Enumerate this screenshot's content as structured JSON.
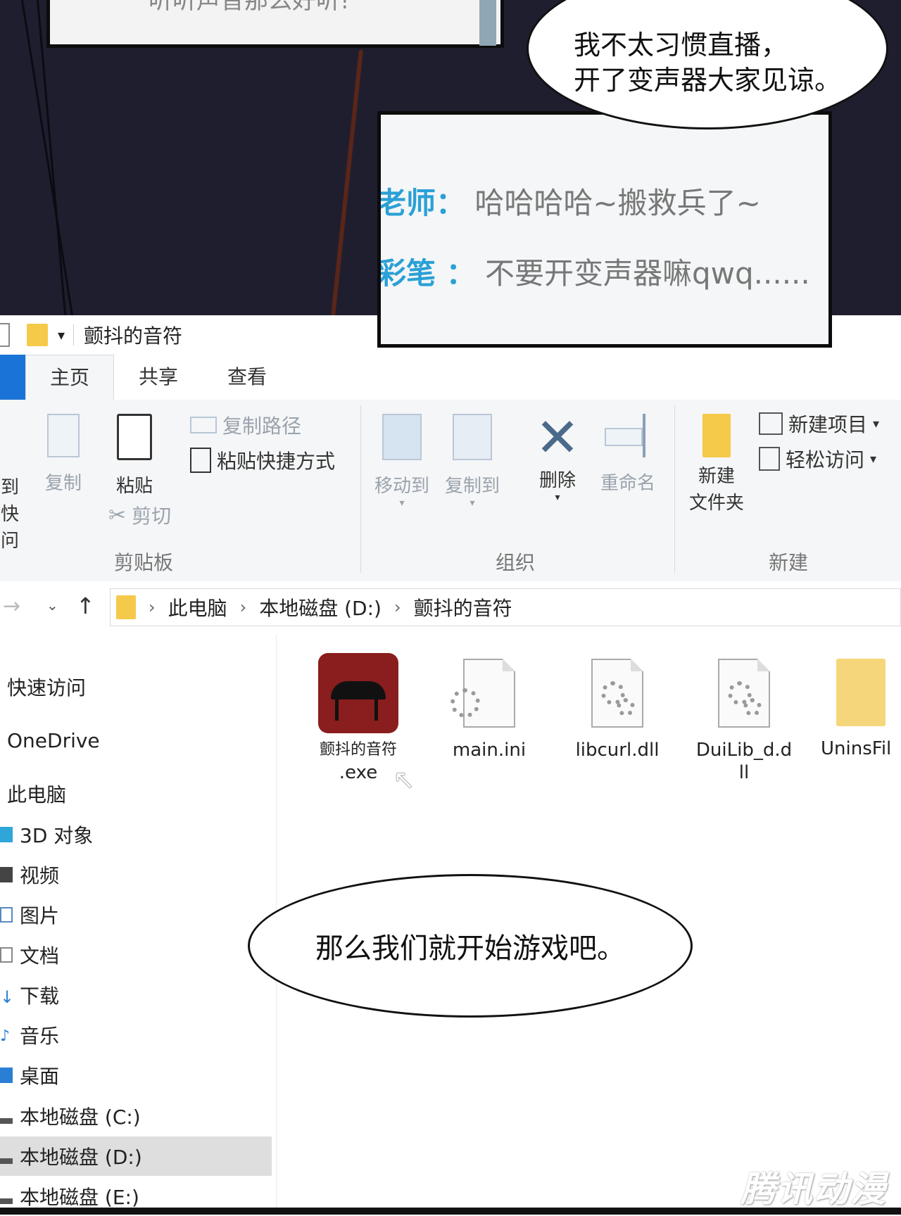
{
  "comic": {
    "top_panel_text": "听听声音那么好听!",
    "bubble_top_line1": "我不太习惯直播，",
    "bubble_top_line2": "开了变声器大家见谅。",
    "chat": [
      {
        "name": "老师：",
        "message": "哈哈哈哈~搬救兵了~"
      },
      {
        "name": "彩笔 ：",
        "message": "不要开变声器嘛qwq......"
      }
    ],
    "bubble_bottom": "那么我们就开始游戏吧。",
    "watermark": "腾讯动漫"
  },
  "explorer": {
    "window_title": "颤抖的音符",
    "tabs": {
      "home": "主页",
      "share": "共享",
      "view": "查看"
    },
    "ribbon": {
      "pin_label_1": "到快",
      "pin_label_2": "问",
      "copy": "复制",
      "paste": "粘贴",
      "copy_path": "复制路径",
      "paste_shortcut": "粘贴快捷方式",
      "cut": "剪切",
      "clipboard_group": "剪贴板",
      "move_to": "移动到",
      "copy_to": "复制到",
      "delete": "删除",
      "rename": "重命名",
      "organize_group": "组织",
      "new_folder_1": "新建",
      "new_folder_2": "文件夹",
      "new_item": "新建项目",
      "easy_access": "轻松访问",
      "new_group": "新建"
    },
    "breadcrumb": [
      "此电脑",
      "本地磁盘 (D:)",
      "颤抖的音符"
    ],
    "nav": {
      "quick_access": "快速访问",
      "onedrive": "OneDrive",
      "this_pc": "此电脑",
      "objects3d": "3D 对象",
      "videos": "视频",
      "pictures": "图片",
      "documents": "文档",
      "downloads": "下载",
      "music": "音乐",
      "desktop": "桌面",
      "drive_c": "本地磁盘 (C:)",
      "drive_d": "本地磁盘 (D:)",
      "drive_e": "本地磁盘 (E:)"
    },
    "files": [
      {
        "name_1": "颤抖的音符",
        "name_2": ".exe"
      },
      {
        "name_1": "main.ini",
        "name_2": ""
      },
      {
        "name_1": "libcurl.dll",
        "name_2": ""
      },
      {
        "name_1": "DuiLib_d.d",
        "name_2": "ll"
      },
      {
        "name_1": "UninsFil",
        "name_2": ""
      }
    ],
    "colors": {
      "accent": "#1a73d6",
      "selected": "#dedede",
      "folder": "#f5c94a"
    }
  }
}
